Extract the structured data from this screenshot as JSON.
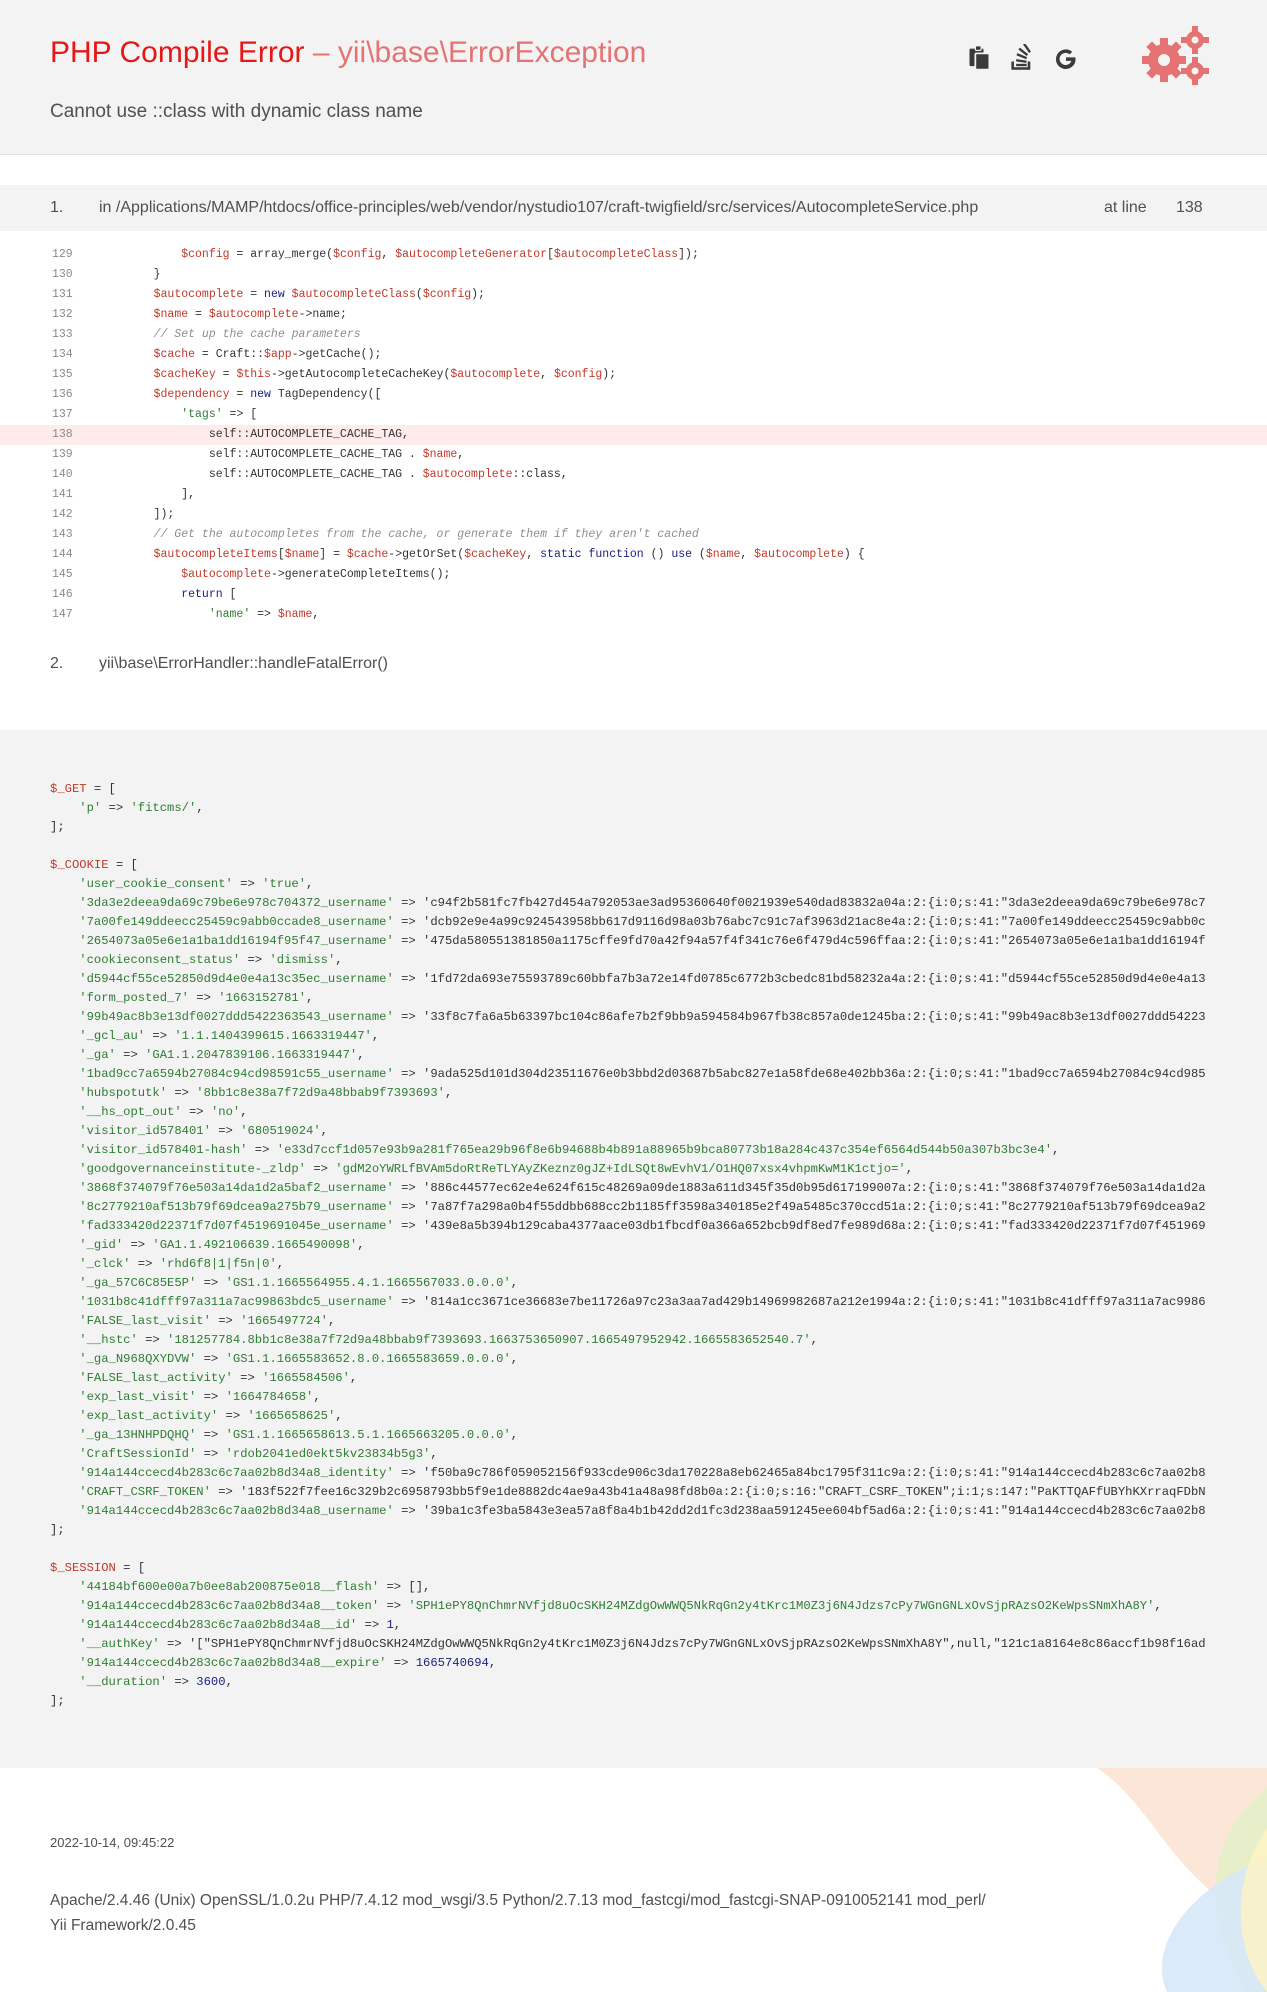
{
  "header": {
    "error_type": "PHP Compile Error",
    "dash": " – ",
    "exception_class": "yii\\base\\ErrorException",
    "message": "Cannot use ::class with dynamic class name",
    "icons": [
      "copy-stacktrace-icon",
      "stackoverflow-search-icon",
      "google-search-icon",
      "gears-logo-icon"
    ],
    "colors": {
      "title": "#e51717",
      "exception": "#e57373",
      "gear": "#e57373"
    }
  },
  "call_stack": [
    {
      "number": "1.",
      "path": "in /Applications/MAMP/htdocs/office-principles/web/vendor/nystudio107/craft-twigfield/src/services/AutocompleteService.php",
      "at_line_label": "at line",
      "line": "138"
    },
    {
      "number": "2.",
      "path": "yii\\base\\ErrorHandler::handleFatalError()"
    }
  ],
  "code": {
    "error_line": 138,
    "lines": [
      {
        "n": "129",
        "code": "        $config = array_merge($config, $autocompleteGenerator[$autocompleteClass]);"
      },
      {
        "n": "130",
        "code": "    }"
      },
      {
        "n": "131",
        "code": "    $autocomplete = new $autocompleteClass($config);"
      },
      {
        "n": "132",
        "code": "    $name = $autocomplete->name;"
      },
      {
        "n": "133",
        "code": "    // Set up the cache parameters"
      },
      {
        "n": "134",
        "code": "    $cache = Craft::$app->getCache();"
      },
      {
        "n": "135",
        "code": "    $cacheKey = $this->getAutocompleteCacheKey($autocomplete, $config);"
      },
      {
        "n": "136",
        "code": "    $dependency = new TagDependency(["
      },
      {
        "n": "137",
        "code": "        'tags' => ["
      },
      {
        "n": "138",
        "code": "            self::AUTOCOMPLETE_CACHE_TAG,"
      },
      {
        "n": "139",
        "code": "            self::AUTOCOMPLETE_CACHE_TAG . $name,"
      },
      {
        "n": "140",
        "code": "            self::AUTOCOMPLETE_CACHE_TAG . $autocomplete::class,"
      },
      {
        "n": "141",
        "code": "        ],"
      },
      {
        "n": "142",
        "code": "    ]);"
      },
      {
        "n": "143",
        "code": "    // Get the autocompletes from the cache, or generate them if they aren't cached"
      },
      {
        "n": "144",
        "code": "    $autocompleteItems[$name] = $cache->getOrSet($cacheKey, static function () use ($name, $autocomplete) {"
      },
      {
        "n": "145",
        "code": "        $autocomplete->generateCompleteItems();"
      },
      {
        "n": "146",
        "code": "        return ["
      },
      {
        "n": "147",
        "code": "            'name' => $name,"
      }
    ]
  },
  "request": {
    "get": [
      "$_GET = [",
      "    'p' => 'fitcms/',",
      "];"
    ],
    "cookie": [
      "$_COOKIE = [",
      "    'user_cookie_consent' => 'true',",
      "    '3da3e2deea9da69c79be6e978c704372_username' => 'c94f2b581fc7fb427d454a792053ae3ad95360640f0021939e540dad83832a04a:2:{i:0;s:41:\"3da3e2deea9da69c79be6e978c7",
      "    '7a00fe149ddeecc25459c9abb0ccade8_username' => 'dcb92e9e4a99c924543958bb617d9116d98a03b76abc7c91c7af3963d21ac8e4a:2:{i:0;s:41:\"7a00fe149ddeecc25459c9abb0c",
      "    '2654073a05e6e1a1ba1dd16194f95f47_username' => '475da580551381850a1175cffe9fd70a42f94a57f4f341c76e6f479d4c596ffaa:2:{i:0;s:41:\"2654073a05e6e1a1ba1dd16194f",
      "    'cookieconsent_status' => 'dismiss',",
      "    'd5944cf55ce52850d9d4e0e4a13c35ec_username' => '1fd72da693e75593789c60bbfa7b3a72e14fd0785c6772b3cbedc81bd58232a4a:2:{i:0;s:41:\"d5944cf55ce52850d9d4e0e4a13",
      "    'form_posted_7' => '1663152781',",
      "    '99b49ac8b3e13df0027ddd5422363543_username' => '33f8c7fa6a5b63397bc104c86afe7b2f9bb9a594584b967fb38c857a0de1245ba:2:{i:0;s:41:\"99b49ac8b3e13df0027ddd54223",
      "    '_gcl_au' => '1.1.1404399615.1663319447',",
      "    '_ga' => 'GA1.1.2047839106.1663319447',",
      "    '1bad9cc7a6594b27084c94cd98591c55_username' => '9ada525d101d304d23511676e0b3bbd2d03687b5abc827e1a58fde68e402bb36a:2:{i:0;s:41:\"1bad9cc7a6594b27084c94cd985",
      "    'hubspotutk' => '8bb1c8e38a7f72d9a48bbab9f7393693',",
      "    '__hs_opt_out' => 'no',",
      "    'visitor_id578401' => '680519024',",
      "    'visitor_id578401-hash' => 'e33d7ccf1d057e93b9a281f765ea29b96f8e6b94688b4b891a88965b9bca80773b18a284c437c354ef6564d544b50a307b3bc3e4',",
      "    'goodgovernanceinstitute-_zldp' => 'gdM2oYWRLfBVAm5doRtReTLYAyZKeznz0gJZ+IdLSQt8wEvhV1/O1HQ07xsx4vhpmKwM1K1ctjo=',",
      "    '3868f374079f76e503a14da1d2a5baf2_username' => '886c44577ec62e4e624f615c48269a09de1883a611d345f35d0b95d617199007a:2:{i:0;s:41:\"3868f374079f76e503a14da1d2a",
      "    '8c2779210af513b79f69dcea9a275b79_username' => '7a87f7a298a0b4f55ddbb688cc2b1185ff3598a340185e2f49a5485c370ccd51a:2:{i:0;s:41:\"8c2779210af513b79f69dcea9a2",
      "    'fad333420d22371f7d07f4519691045e_username' => '439e8a5b394b129caba4377aace03db1fbcdf0a366a652bcb9df8ed7fe989d68a:2:{i:0;s:41:\"fad333420d22371f7d07f451969",
      "    '_gid' => 'GA1.1.492106639.1665490098',",
      "    '_clck' => 'rhd6f8|1|f5n|0',",
      "    '_ga_57C6C85E5P' => 'GS1.1.1665564955.4.1.1665567033.0.0.0',",
      "    '1031b8c41dfff97a311a7ac99863bdc5_username' => '814a1cc3671ce36683e7be11726a97c23a3aa7ad429b14969982687a212e1994a:2:{i:0;s:41:\"1031b8c41dfff97a311a7ac9986",
      "    'FALSE_last_visit' => '1665497724',",
      "    '__hstc' => '181257784.8bb1c8e38a7f72d9a48bbab9f7393693.1663753650907.1665497952942.1665583652540.7',",
      "    '_ga_N968QXYDVW' => 'GS1.1.1665583652.8.0.1665583659.0.0.0',",
      "    'FALSE_last_activity' => '1665584506',",
      "    'exp_last_visit' => '1664784658',",
      "    'exp_last_activity' => '1665658625',",
      "    '_ga_13HNHPDQHQ' => 'GS1.1.1665658613.5.1.1665663205.0.0.0',",
      "    'CraftSessionId' => 'rdob2041ed0ekt5kv23834b5g3',",
      "    '914a144ccecd4b283c6c7aa02b8d34a8_identity' => 'f50ba9c786f059052156f933cde906c3da170228a8eb62465a84bc1795f311c9a:2:{i:0;s:41:\"914a144ccecd4b283c6c7aa02b8",
      "    'CRAFT_CSRF_TOKEN' => '183f522f7fee16c329b2c6958793bb5f9e1de8882dc4ae9a43b41a48a98fd8b0a:2:{i:0;s:16:\"CRAFT_CSRF_TOKEN\";i:1;s:147:\"PaKTTQAFfUBYhKXrraqFDbN",
      "    '914a144ccecd4b283c6c7aa02b8d34a8_username' => '39ba1c3fe3ba5843e3ea57a8f8a4b1b42dd2d1fc3d238aa591245ee604bf5ad6a:2:{i:0;s:41:\"914a144ccecd4b283c6c7aa02b8",
      "];"
    ],
    "session": [
      "$_SESSION = [",
      "    '44184bf600e00a7b0ee8ab200875e018__flash' => [],",
      "    '914a144ccecd4b283c6c7aa02b8d34a8__token' => 'SPH1ePY8QnChmrNVfjd8uOcSKH24MZdgOwWWQ5NkRqGn2y4tKrc1M0Z3j6N4Jdzs7cPy7WGnGNLxOvSjpRAzsO2KeWpsSNmXhA8Y',",
      "    '914a144ccecd4b283c6c7aa02b8d34a8__id' => 1,",
      "    '__authKey' => '[\"SPH1ePY8QnChmrNVfjd8uOcSKH24MZdgOwWWQ5NkRqGn2y4tKrc1M0Z3j6N4Jdzs7cPy7WGnGNLxOvSjpRAzsO2KeWpsSNmXhA8Y\",null,\"121c1a8164e8c86accf1b98f16ad",
      "    '914a144ccecd4b283c6c7aa02b8d34a8__expire' => 1665740694,",
      "    '__duration' => 3600,",
      "];"
    ]
  },
  "footer": {
    "timestamp": "2022-10-14, 09:45:22",
    "server_line1": "Apache/2.4.46 (Unix) OpenSSL/1.0.2u PHP/7.4.12 mod_wsgi/3.5 Python/2.7.13 mod_fastcgi/mod_fastcgi-SNAP-0910052141 mod_perl/",
    "server_line2": "Yii Framework/2.0.45"
  }
}
